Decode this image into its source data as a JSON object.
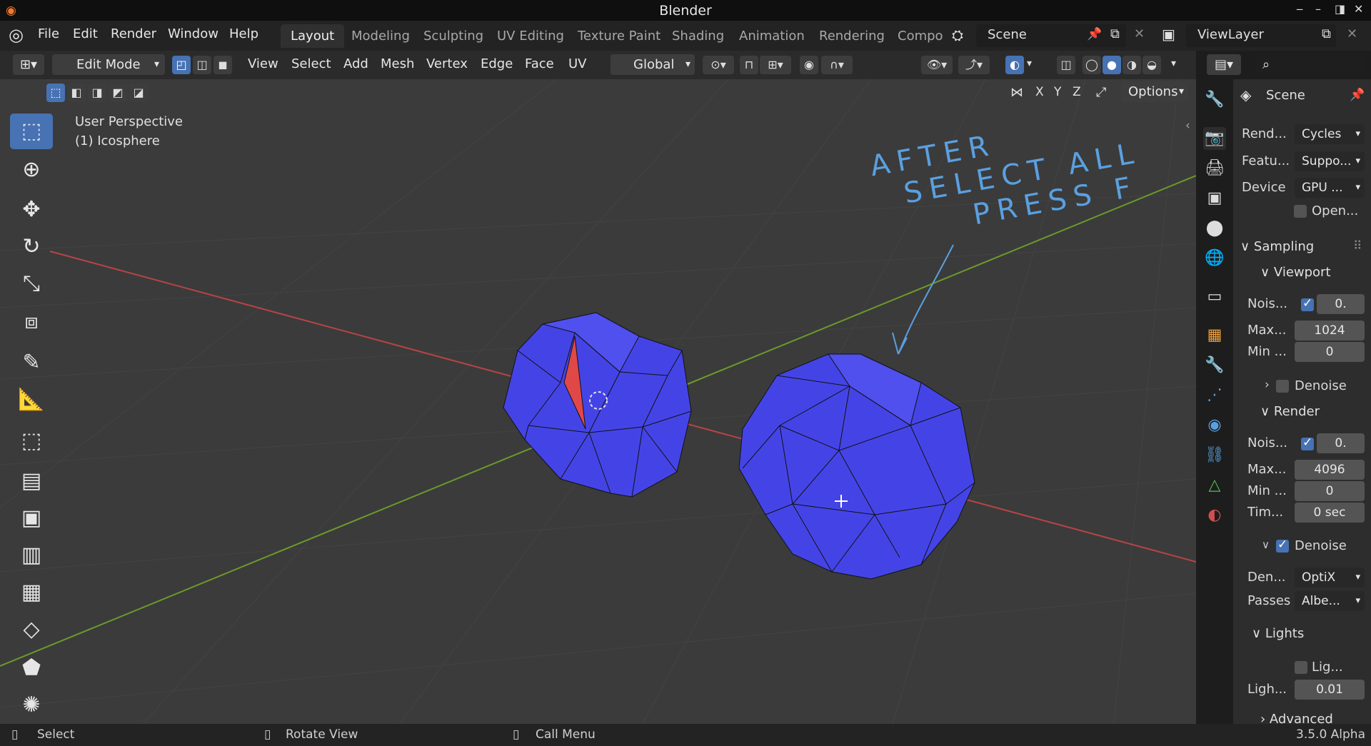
{
  "window": {
    "title": "Blender"
  },
  "menu": [
    "File",
    "Edit",
    "Render",
    "Window",
    "Help"
  ],
  "workspaces": [
    "Layout",
    "Modeling",
    "Sculpting",
    "UV Editing",
    "Texture Paint",
    "Shading",
    "Animation",
    "Rendering",
    "Compo"
  ],
  "scene": {
    "name": "Scene",
    "view_layer": "ViewLayer"
  },
  "viewport_header": {
    "mode": "Edit Mode",
    "menus": [
      "View",
      "Select",
      "Add",
      "Mesh",
      "Vertex",
      "Edge",
      "Face",
      "UV"
    ],
    "transform_orientation": "Global",
    "options_label": "Options",
    "axes": [
      "X",
      "Y",
      "Z"
    ]
  },
  "viewport": {
    "perspective": "User Perspective",
    "object": "(1) Icosphere",
    "annotation": [
      "AFTER",
      "SELECT ALL",
      "PRESS F"
    ]
  },
  "properties": {
    "scene_title": "Scene",
    "render_engine_label": "Rend...",
    "render_engine": "Cycles",
    "feature_label": "Featu...",
    "feature": "Suppo...",
    "device_label": "Device",
    "device": "GPU ...",
    "open_label": "Open...",
    "sampling": "Sampling",
    "viewport": {
      "title": "Viewport",
      "noise_label": "Nois...",
      "noise": "0.",
      "max_label": "Max...",
      "max": "1024",
      "min_label": "Min ...",
      "min": "0",
      "denoise": "Denoise"
    },
    "render": {
      "title": "Render",
      "noise_label": "Nois...",
      "noise": "0.",
      "max_label": "Max...",
      "max": "4096",
      "min_label": "Min ...",
      "min": "0",
      "time_label": "Tim...",
      "time": "0 sec",
      "denoise": "Denoise",
      "denoiser_label": "Den...",
      "denoiser": "OptiX",
      "passes_label": "Passes",
      "passes": "Albe..."
    },
    "lights": {
      "title": "Lights",
      "light_tree_label": "Lig...",
      "threshold_label": "Ligh...",
      "threshold": "0.01"
    },
    "advanced": "Advanced"
  },
  "statusbar": {
    "select": "Select",
    "rotate": "Rotate View",
    "call_menu": "Call Menu",
    "version": "3.5.0 Alpha"
  },
  "colors": {
    "accent": "#4772b3",
    "mesh": "#4040e0",
    "selected_face": "#e04848",
    "x_axis": "#b84444",
    "y_axis": "#6d9a2a",
    "annotation": "#5aa0e0"
  }
}
